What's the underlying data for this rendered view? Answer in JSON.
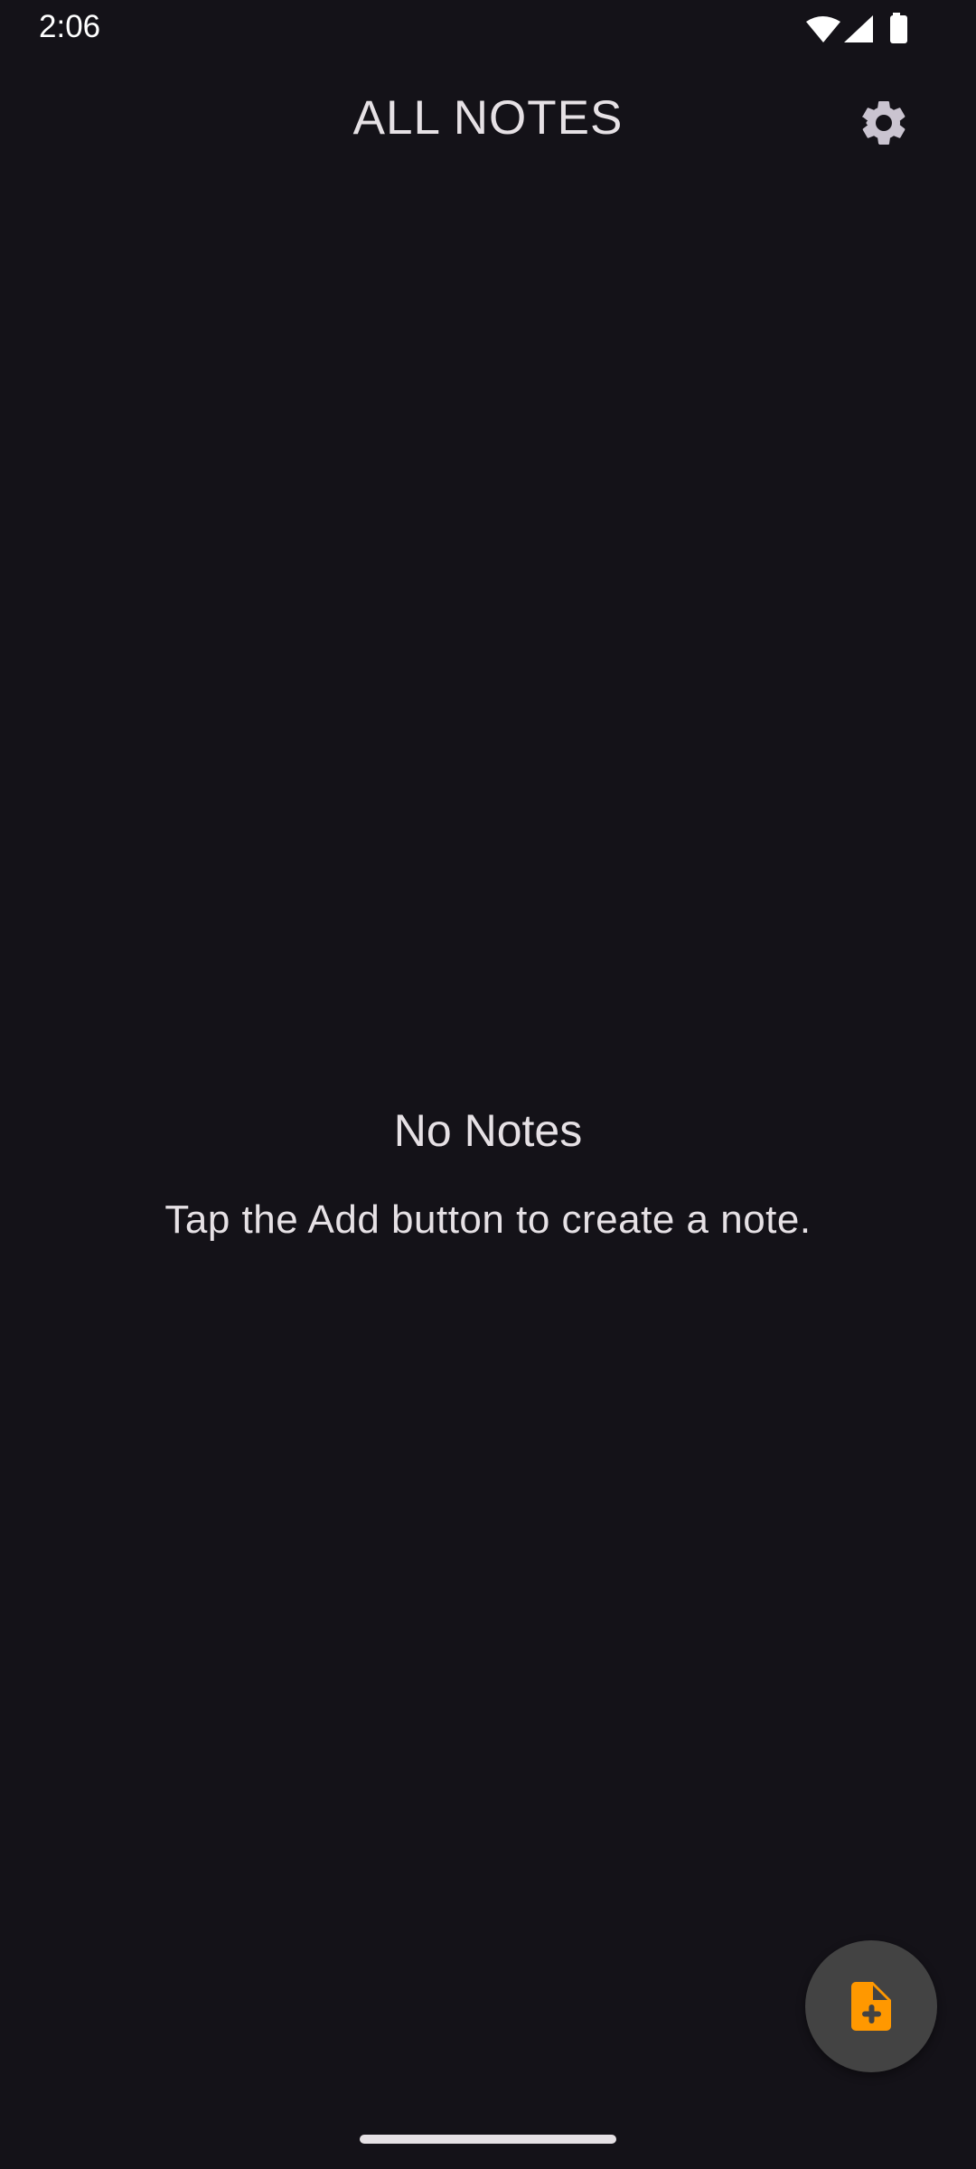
{
  "status_bar": {
    "time": "2:06",
    "icons": [
      "wifi-icon",
      "signal-icon",
      "battery-icon"
    ]
  },
  "header": {
    "title": "ALL NOTES",
    "settings_icon": "gear-icon"
  },
  "empty_state": {
    "title": "No Notes",
    "subtitle": "Tap the Add button to create a note."
  },
  "fab": {
    "icon": "note-add-icon",
    "accent_color": "#FF9800",
    "background_color": "#434343"
  },
  "colors": {
    "background": "#141218",
    "text": "#E6E1E5",
    "icon": "#CAC4D0"
  }
}
